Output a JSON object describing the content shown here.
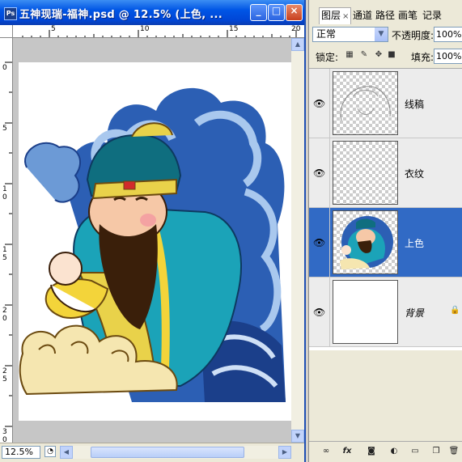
{
  "document_window": {
    "title": "五神现瑞-福神.psd @ 12.5% (上色, ...",
    "app_icon_label": "Ps",
    "controls": {
      "minimize": "_",
      "maximize": "□",
      "close": "×"
    },
    "ruler_h_labels": [
      "5",
      "10",
      "15",
      "20"
    ],
    "ruler_v_labels": [
      "0",
      "5",
      "1 0",
      "1 5",
      "2 0",
      "2 5",
      "3 0"
    ],
    "zoom": "12.5%"
  },
  "layers_panel": {
    "tabs": [
      {
        "label": "图层",
        "active": true
      },
      {
        "label": "通道"
      },
      {
        "label": "路径"
      },
      {
        "label": "画笔"
      },
      {
        "label": "记录"
      }
    ],
    "tab_close": "×",
    "blend_mode": "正常",
    "opacity_label": "不透明度:",
    "opacity_value": "100%",
    "lock_label": "锁定:",
    "fill_label": "填充:",
    "fill_value": "100%",
    "layers": [
      {
        "name": "线稿",
        "visible": true,
        "selected": false,
        "locked": false
      },
      {
        "name": "衣纹",
        "visible": true,
        "selected": false,
        "locked": false
      },
      {
        "name": "上色",
        "visible": true,
        "selected": true,
        "locked": false
      },
      {
        "name": "背景",
        "visible": true,
        "selected": false,
        "locked": true
      }
    ],
    "footer_icons": [
      "link-icon",
      "fx-icon",
      "mask-icon",
      "adjustment-icon",
      "folder-icon",
      "new-layer-icon",
      "trash-icon"
    ]
  },
  "colors": {
    "titlebar_blue": "#0055e5",
    "selected_layer": "#316ac5",
    "wave_blue": "#2c5fb4",
    "robe_teal": "#1ba3b8"
  }
}
